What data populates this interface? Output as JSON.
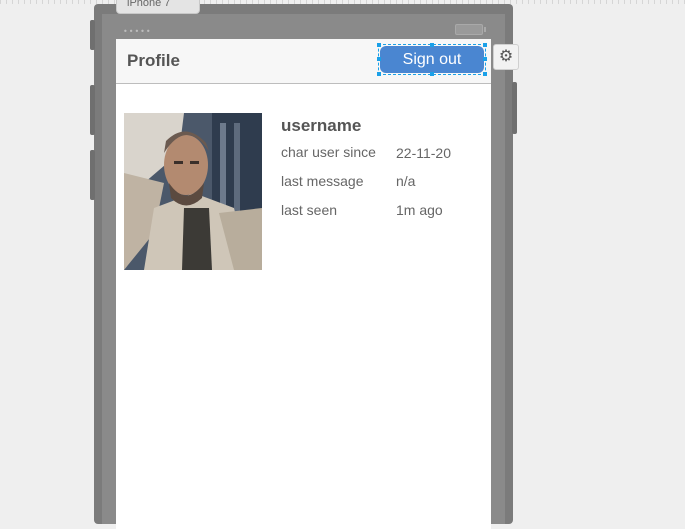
{
  "device": {
    "tab_label": "iPhone 7",
    "status_dots": "•••••"
  },
  "header": {
    "title": "Profile",
    "signout_label": "Sign out"
  },
  "settings": {
    "icon": "gear-icon",
    "glyph": "⚙"
  },
  "profile": {
    "username": "username",
    "rows": [
      {
        "label": "char user since",
        "value": "22-11-20"
      },
      {
        "label": "last message",
        "value": "n/a"
      },
      {
        "label": "last seen",
        "value": "1m ago"
      }
    ]
  },
  "colors": {
    "accent": "#4a86d1",
    "selection": "#1aa0e8"
  }
}
